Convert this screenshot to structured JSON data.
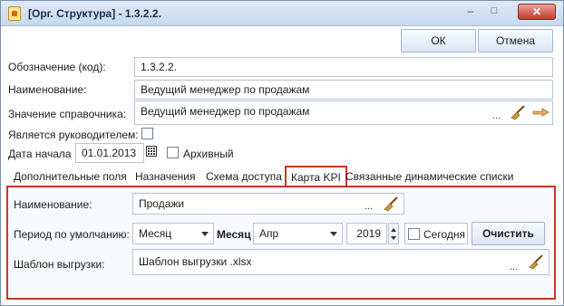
{
  "window": {
    "title": "[Орг. Структура] - 1.3.2.2.",
    "minimize_glyph": "–",
    "maximize_glyph": "□",
    "close_glyph": "✕"
  },
  "toolbar": {
    "ok_label": "ОК",
    "cancel_label": "Отмена"
  },
  "form": {
    "code_label": "Обозначение (код):",
    "code_value": "1.3.2.2.",
    "name_label": "Наименование:",
    "name_value": "Ведущий менеджер по продажам",
    "ref_label": "Значение справочника:",
    "ref_value": "Ведущий менеджер по продажам",
    "ref_dots": "...",
    "is_head_label": "Является руководителем:",
    "is_head_checked": false,
    "start_date_label": "Дата начала",
    "start_date_value": "01.01.2013",
    "archive_label": "Архивный",
    "archive_checked": false
  },
  "tabs": [
    {
      "label": "Дополнительные поля",
      "active": false
    },
    {
      "label": "Назначения",
      "active": false
    },
    {
      "label": "Схема доступа",
      "active": false
    },
    {
      "label": "Карта KPI",
      "active": true
    },
    {
      "label": "Связанные динамические списки",
      "active": false
    }
  ],
  "kpi": {
    "name_label": "Наименование:",
    "name_value": "Продажи",
    "name_dots": "...",
    "period_label": "Период по умолчанию:",
    "period_value": "Месяц",
    "month_label": "Месяц",
    "month_value": "Апр",
    "year_value": "2019",
    "today_label": "Сегодня",
    "today_checked": false,
    "clear_label": "Очистить",
    "template_label": "Шаблон выгрузки:",
    "template_value": "Шаблон выгрузки .xlsx",
    "template_dots": "..."
  },
  "colors": {
    "highlight": "#c0392b",
    "accent": "#1c2f4a"
  }
}
